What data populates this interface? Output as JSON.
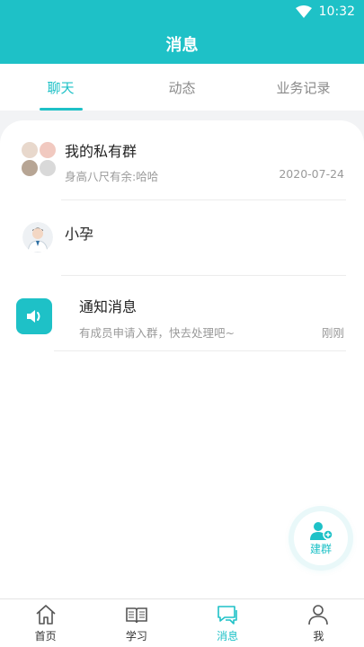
{
  "status_bar": {
    "time": "10:32"
  },
  "header": {
    "title": "消息"
  },
  "tabs": [
    {
      "label": "聊天",
      "active": true
    },
    {
      "label": "动态",
      "active": false
    },
    {
      "label": "业务记录",
      "active": false
    }
  ],
  "conversations": [
    {
      "name": "我的私有群",
      "preview": "身高八尺有余:哈哈",
      "time": "2020-07-24",
      "avatar": "group-avatar"
    },
    {
      "name": "小孕",
      "preview": "",
      "time": "",
      "avatar": "doctor-avatar"
    },
    {
      "name": "通知消息",
      "preview": "有成员申请入群，快去处理吧~",
      "time": "刚刚",
      "avatar": "speaker-icon"
    }
  ],
  "fab": {
    "label": "建群",
    "icon": "add-user-icon"
  },
  "bottom_nav": [
    {
      "label": "首页",
      "icon": "home-icon",
      "active": false
    },
    {
      "label": "学习",
      "icon": "book-icon",
      "active": false
    },
    {
      "label": "消息",
      "icon": "chat-icon",
      "active": true
    },
    {
      "label": "我",
      "icon": "person-icon",
      "active": false
    }
  ],
  "colors": {
    "accent": "#1ec1c7",
    "background": "#f2f3f5",
    "text_secondary": "#9a9a9a"
  }
}
